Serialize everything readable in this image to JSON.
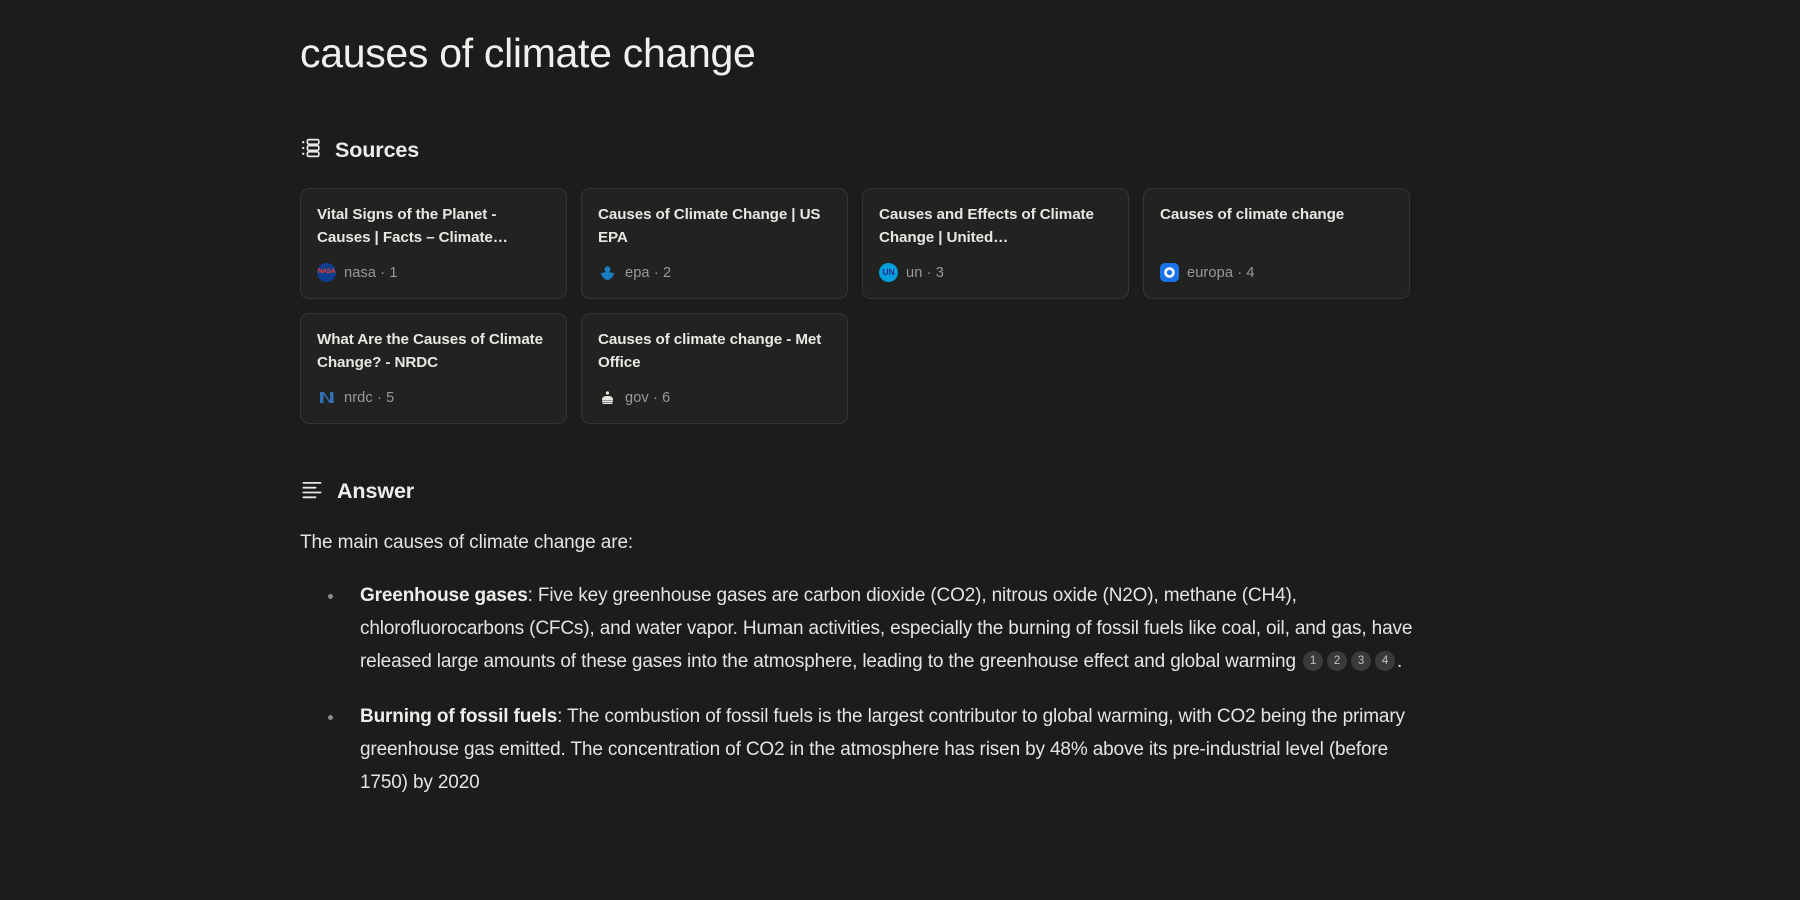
{
  "query": {
    "title": "causes of climate change"
  },
  "sources_section": {
    "icon": "sources-list-icon",
    "label": "Sources",
    "cards": [
      {
        "title": "Vital Signs of the Planet - Causes | Facts – Climate…",
        "domain": "nasa",
        "index": "1",
        "favicon": "nasa-favicon",
        "favicon_text": "NASA"
      },
      {
        "title": "Causes of Climate Change | US EPA",
        "domain": "epa",
        "index": "2",
        "favicon": "epa-favicon",
        "favicon_text": ""
      },
      {
        "title": "Causes and Effects of Climate Change | United…",
        "domain": "un",
        "index": "3",
        "favicon": "un-favicon",
        "favicon_text": "UN"
      },
      {
        "title": "Causes of climate change",
        "domain": "europa",
        "index": "4",
        "favicon": "europa-favicon",
        "favicon_text": ""
      },
      {
        "title": "What Are the Causes of Climate Change? - NRDC",
        "domain": "nrdc",
        "index": "5",
        "favicon": "nrdc-favicon",
        "favicon_text": "N"
      },
      {
        "title": "Causes of climate change - Met Office",
        "domain": "gov",
        "index": "6",
        "favicon": "gov-crown-favicon",
        "favicon_text": ""
      }
    ],
    "separator": "·"
  },
  "answer_section": {
    "icon": "answer-lines-icon",
    "label": "Answer",
    "lead": "The main causes of climate change are:",
    "bullets": [
      {
        "term": "Greenhouse gases",
        "text_before": ": Five key greenhouse gases are carbon dioxide (CO2), nitrous oxide (N2O), methane (CH4), chlorofluorocarbons (CFCs), and water vapor. Human activities, especially the burning of fossil fuels like coal, oil, and gas, have released large amounts of these gases into the atmosphere, leading to the greenhouse effect and global warming ",
        "citations": [
          "1",
          "2",
          "3",
          "4"
        ],
        "text_after": "."
      },
      {
        "term": "Burning of fossil fuels",
        "text_before": ": The combustion of fossil fuels is the largest contributor to global warming, with CO2 being the primary greenhouse gas emitted. The concentration of CO2 in the atmosphere has risen by 48% above its pre-industrial level (before 1750) by 2020",
        "citations": [],
        "text_after": ""
      }
    ]
  },
  "colors": {
    "background": "#1c1c1c",
    "card_background": "#222221",
    "card_border": "#343433",
    "text_primary": "#e6e4e1",
    "text_muted": "#9b9996",
    "citation_chip": "#3a3a39"
  }
}
